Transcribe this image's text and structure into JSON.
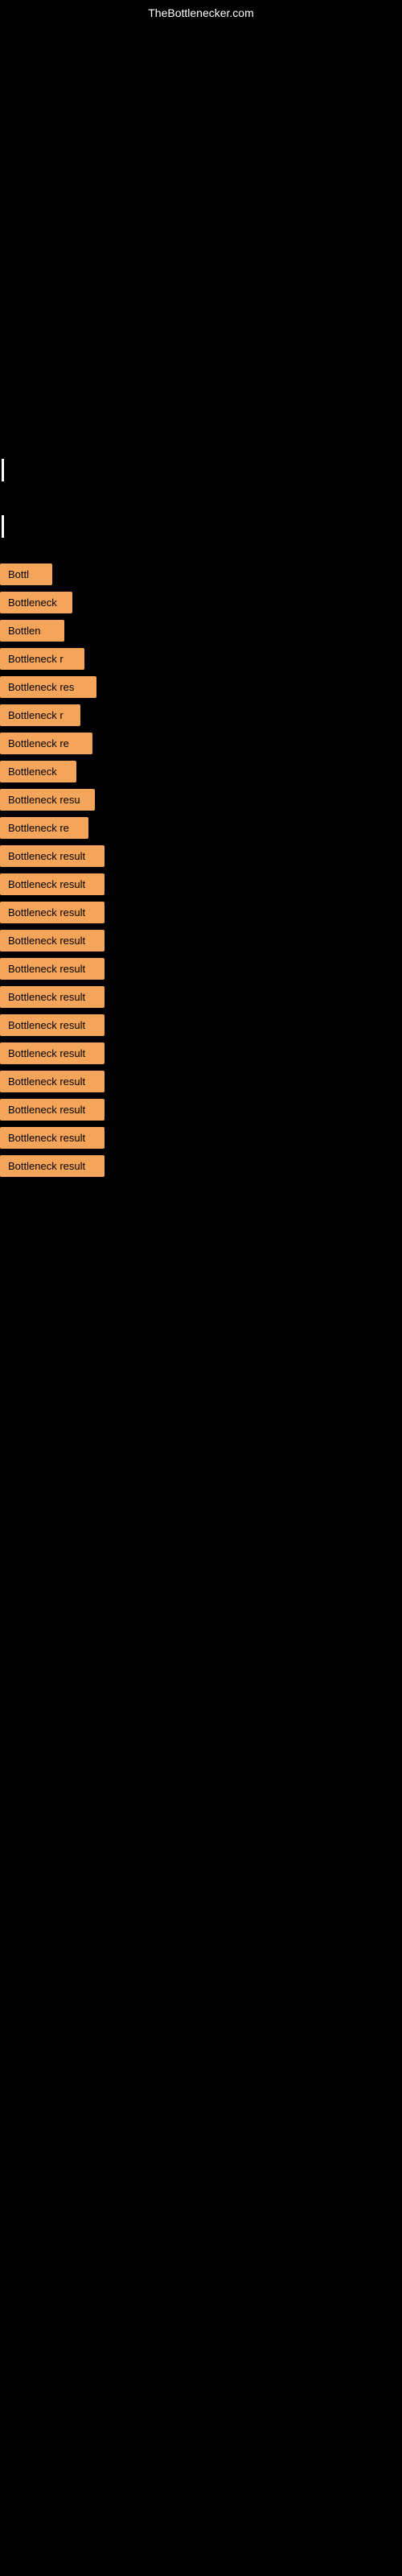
{
  "site": {
    "title": "TheBottlenecker.com"
  },
  "bottleneck_items": [
    {
      "label": "Bottl"
    },
    {
      "label": "Bottleneck"
    },
    {
      "label": "Bottlen"
    },
    {
      "label": "Bottleneck r"
    },
    {
      "label": "Bottleneck res"
    },
    {
      "label": "Bottleneck r"
    },
    {
      "label": "Bottleneck re"
    },
    {
      "label": "Bottleneck"
    },
    {
      "label": "Bottleneck resu"
    },
    {
      "label": "Bottleneck re"
    },
    {
      "label": "Bottleneck result"
    },
    {
      "label": "Bottleneck result"
    },
    {
      "label": "Bottleneck result"
    },
    {
      "label": "Bottleneck result"
    },
    {
      "label": "Bottleneck result"
    },
    {
      "label": "Bottleneck result"
    },
    {
      "label": "Bottleneck result"
    },
    {
      "label": "Bottleneck result"
    },
    {
      "label": "Bottleneck result"
    },
    {
      "label": "Bottleneck result"
    },
    {
      "label": "Bottleneck result"
    },
    {
      "label": "Bottleneck result"
    }
  ]
}
